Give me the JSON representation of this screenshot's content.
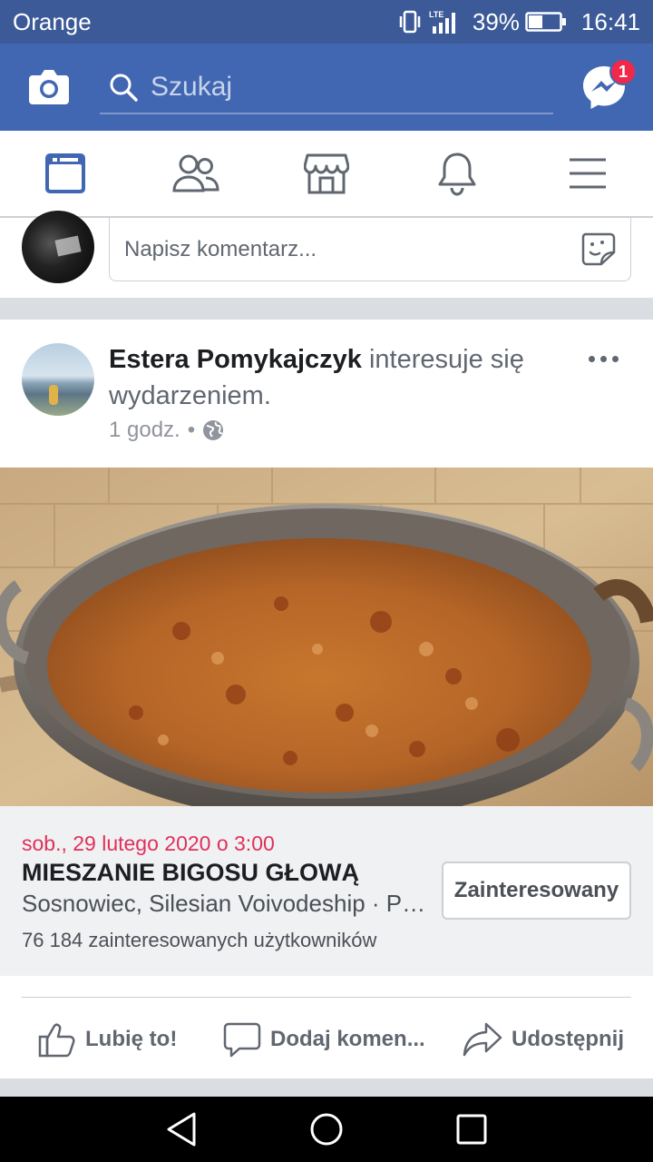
{
  "status_bar": {
    "carrier": "Orange",
    "network": "LTE",
    "battery_percent": "39%",
    "time": "16:41"
  },
  "app_bar": {
    "search_placeholder": "Szukaj",
    "messenger_badge": "1"
  },
  "tabs": [
    "news-feed",
    "friends",
    "marketplace",
    "notifications",
    "menu"
  ],
  "composer": {
    "placeholder": "Napisz komentarz..."
  },
  "post": {
    "author": "Estera Pomykajczyk",
    "action_text": " interesuje się wydarzeniem.",
    "time": "1 godz.",
    "separator": "•",
    "event": {
      "date": "sob., 29 lutego 2020 o 3:00",
      "title": "MIESZANIE BIGOSU GŁOWĄ",
      "location": "Sosnowiec, Silesian Voivodeship · Polska",
      "interested_count": "76 184 zainteresowanych użytkowników",
      "button_label": "Zainteresowany"
    },
    "actions": {
      "like": "Lubię to!",
      "comment": "Dodaj komen...",
      "share": "Udostępnij"
    }
  },
  "colors": {
    "brand": "#4267b2",
    "status_bar": "#3c5a98",
    "event_date": "#e0305a",
    "badge": "#f02849"
  }
}
